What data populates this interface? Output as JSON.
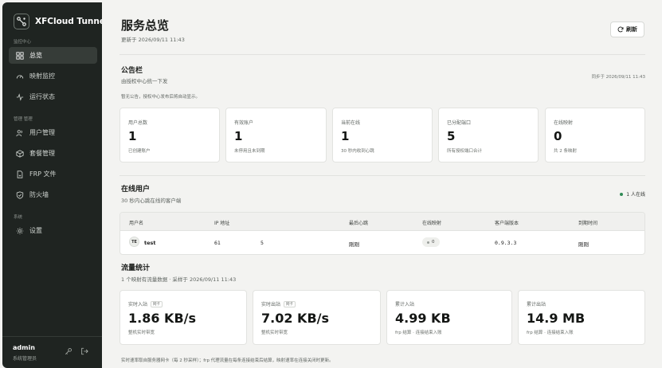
{
  "app": {
    "title": "XFCloud Tunnel"
  },
  "sidebar": {
    "sections": [
      {
        "label": "监控中心"
      },
      {
        "label": "管理 管理"
      },
      {
        "label": "系统"
      }
    ],
    "items": [
      {
        "label": "总览",
        "icon": "dashboard-icon",
        "active": true
      },
      {
        "label": "映射监控",
        "icon": "gauge-icon"
      },
      {
        "label": "运行状态",
        "icon": "activity-icon"
      },
      {
        "label": "用户管理",
        "icon": "users-icon"
      },
      {
        "label": "套餐管理",
        "icon": "package-icon"
      },
      {
        "label": "FRP 文件",
        "icon": "file-icon"
      },
      {
        "label": "防火墙",
        "icon": "shield-icon"
      },
      {
        "label": "设置",
        "icon": "gear-icon"
      }
    ],
    "user": {
      "name": "admin",
      "role": "系统管理员"
    }
  },
  "header": {
    "title": "服务总览",
    "updated": "更新于 2026/09/11 11:43",
    "refresh_label": "刷新"
  },
  "bulletin": {
    "title": "公告栏",
    "subtitle": "由授权中心统一下发",
    "sync": "同步于 2026/09/11 11:43",
    "note": "暂无公告，授权中心发布后将自动显示。"
  },
  "stats": [
    {
      "label": "用户总数",
      "value": "1",
      "desc": "已创建账户"
    },
    {
      "label": "有效账户",
      "value": "1",
      "desc": "未停用且未到期"
    },
    {
      "label": "当前在线",
      "value": "1",
      "desc": "30 秒内收到心跳"
    },
    {
      "label": "已分配端口",
      "value": "5",
      "desc": "所有授权端口合计"
    },
    {
      "label": "在线映射",
      "value": "0",
      "desc": "共 2 条映射"
    }
  ],
  "online": {
    "title": "在线用户",
    "subtitle": "30 秒内心跳在线的客户端",
    "badge": "1 人在线",
    "columns": [
      "用户名",
      "IP 地址",
      "最后心跳",
      "在线映射",
      "客户端版本",
      "到期时间"
    ],
    "rows": [
      {
        "initials": "TE",
        "user": "test",
        "ip": "61",
        "ip_extra": "5",
        "last_heartbeat": "刚刚",
        "mappings": "0",
        "version": "0.9.3.3",
        "expires": "刚刚"
      }
    ]
  },
  "traffic": {
    "title": "流量统计",
    "subtitle": "1 个映射有流量数据 · 采样于 2026/09/11 11:43",
    "cards": [
      {
        "label": "实时入站",
        "tag": "网卡",
        "value": "1.86 KB/s",
        "desc": "整机实时带宽"
      },
      {
        "label": "实时出站",
        "tag": "网卡",
        "value": "7.02 KB/s",
        "desc": "整机实时带宽"
      },
      {
        "label": "累计入站",
        "tag": "",
        "value": "4.99 KB",
        "desc": "frp 结算 · 连接结束入账"
      },
      {
        "label": "累计出站",
        "tag": "",
        "value": "14.9 MB",
        "desc": "frp 结算 · 连接结束入账"
      }
    ],
    "footer": "实时速率取自服务器网卡（每 2 秒采样）；frp 代理流量在每条连接结束后结算，映射速率在连接关闭时更新。"
  }
}
